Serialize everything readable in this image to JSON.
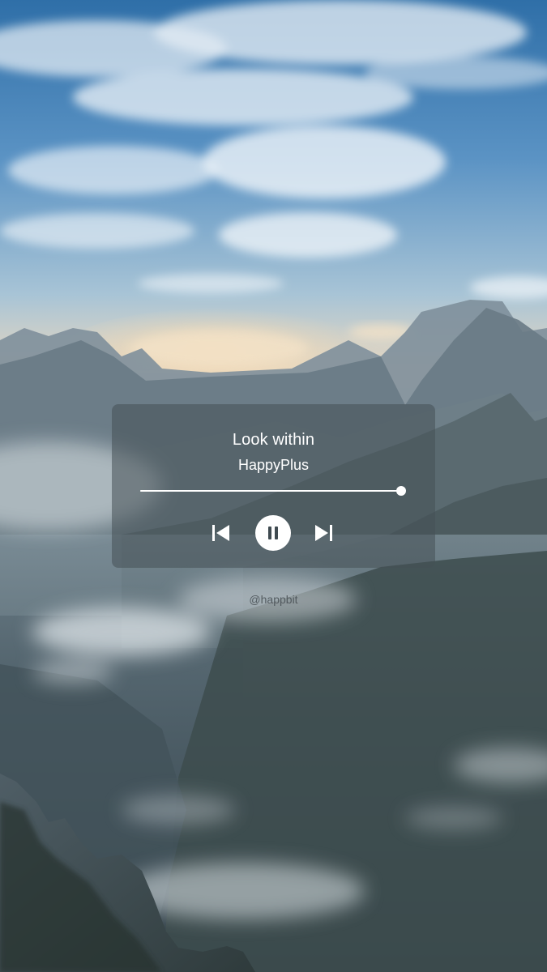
{
  "player": {
    "track_title": "Look within",
    "artist": "HappyPlus",
    "progress_fraction": 1.0,
    "is_playing": true
  },
  "footer": {
    "handle": "@happbit"
  },
  "icons": {
    "previous": "skip-previous-icon",
    "pause": "pause-icon",
    "next": "skip-next-icon"
  },
  "colors": {
    "card_background": "#46505680",
    "foreground": "#ffffff",
    "handle_text": "#464e52"
  }
}
